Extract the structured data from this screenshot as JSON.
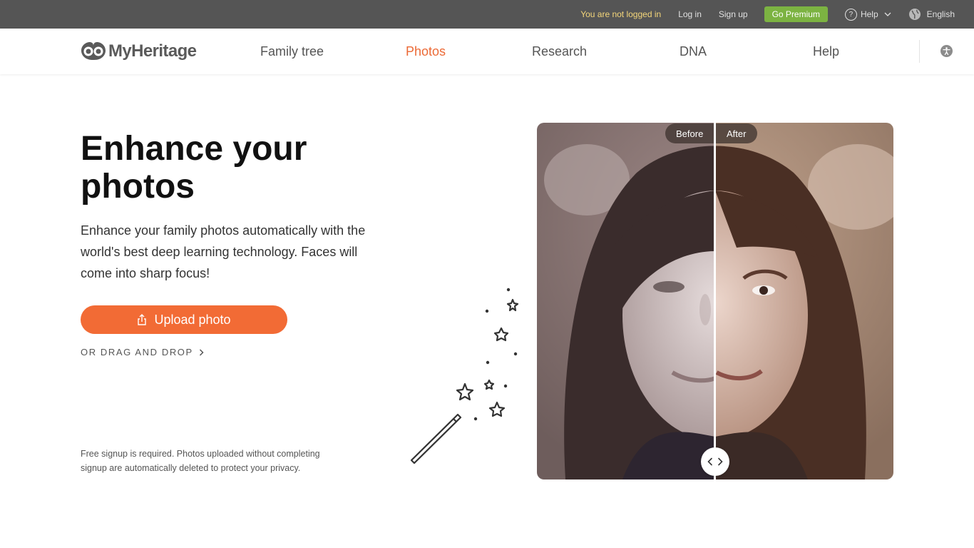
{
  "topbar": {
    "login_status": "You are not logged in",
    "login": "Log in",
    "signup": "Sign up",
    "premium": "Go Premium",
    "help": "Help",
    "language": "English"
  },
  "nav": {
    "brand": "MyHeritage",
    "links": [
      "Family tree",
      "Photos",
      "Research",
      "DNA",
      "Help"
    ],
    "active": "Photos"
  },
  "hero": {
    "title": "Enhance your photos",
    "description": "Enhance your family photos automatically with the world's best deep learning technology. Faces will come into sharp focus!",
    "upload_button": "Upload photo",
    "drag_drop": "OR DRAG AND DROP",
    "notice": "Free signup is required. Photos uploaded without completing signup are automatically deleted to protect your privacy."
  },
  "compare": {
    "before_label": "Before",
    "after_label": "After",
    "split_percent": 50
  },
  "colors": {
    "accent": "#f26b35",
    "premium": "#7cb342",
    "topbar": "#555555",
    "login_status": "#f4d67a"
  }
}
